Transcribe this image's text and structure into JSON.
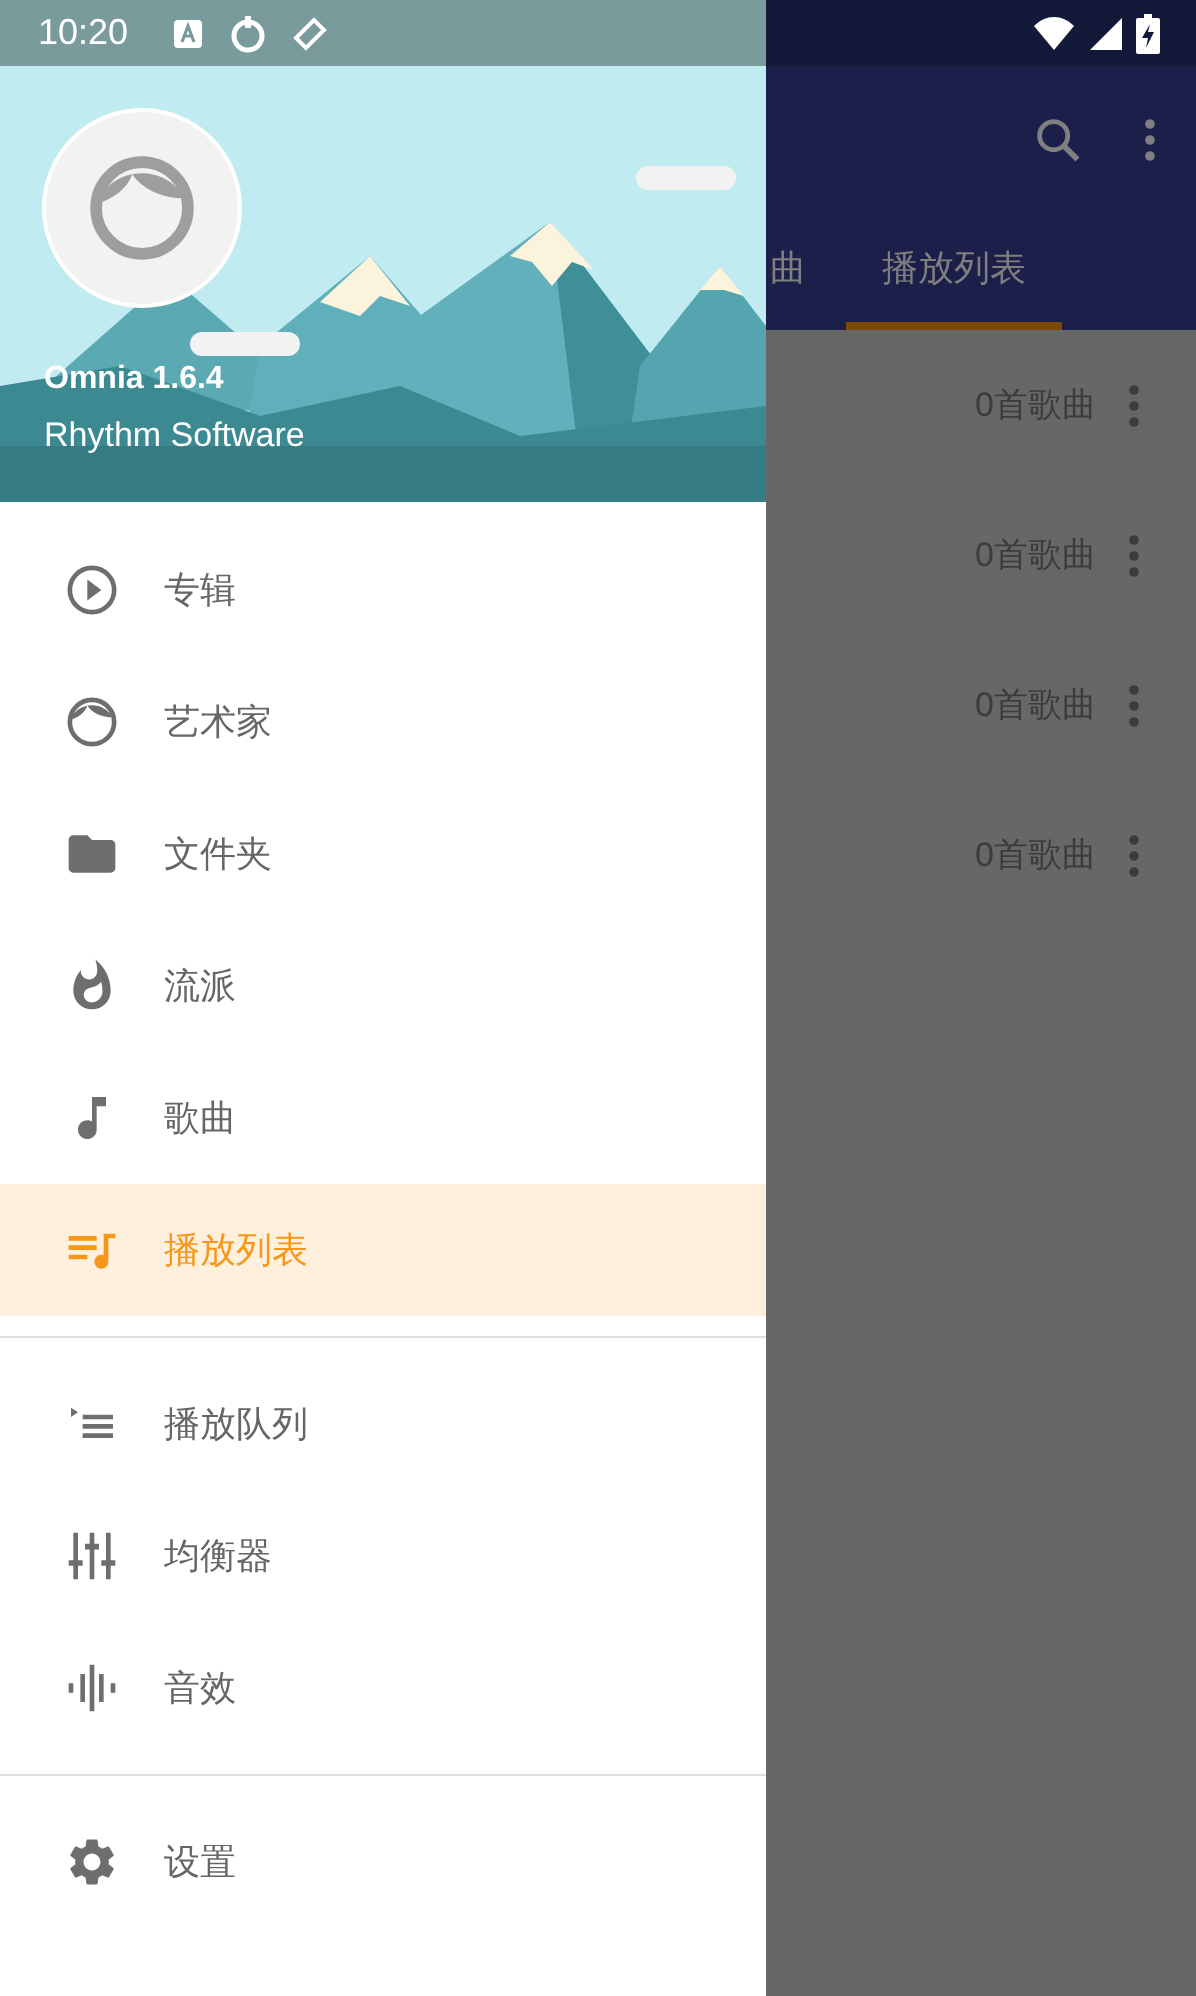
{
  "status_bar": {
    "time": "10:20"
  },
  "drawer": {
    "header": {
      "app_name": "Omnia 1.6.4",
      "publisher": "Rhythm Software"
    },
    "groups": [
      [
        {
          "label": "专辑",
          "selected": false
        },
        {
          "label": "艺术家",
          "selected": false
        },
        {
          "label": "文件夹",
          "selected": false
        },
        {
          "label": "流派",
          "selected": false
        },
        {
          "label": "歌曲",
          "selected": false
        },
        {
          "label": "播放列表",
          "selected": true
        }
      ],
      [
        {
          "label": "播放队列",
          "selected": false
        },
        {
          "label": "均衡器",
          "selected": false
        },
        {
          "label": "音效",
          "selected": false
        }
      ],
      [
        {
          "label": "设置",
          "selected": false
        }
      ]
    ]
  },
  "app_bar": {
    "tabs": [
      {
        "label": "曲",
        "selected": false
      },
      {
        "label": "播放列表",
        "selected": true
      }
    ]
  },
  "playlists": [
    {
      "count": "0首歌曲"
    },
    {
      "count": "0首歌曲"
    },
    {
      "count": "0首歌曲"
    },
    {
      "count": "0首歌曲"
    }
  ]
}
